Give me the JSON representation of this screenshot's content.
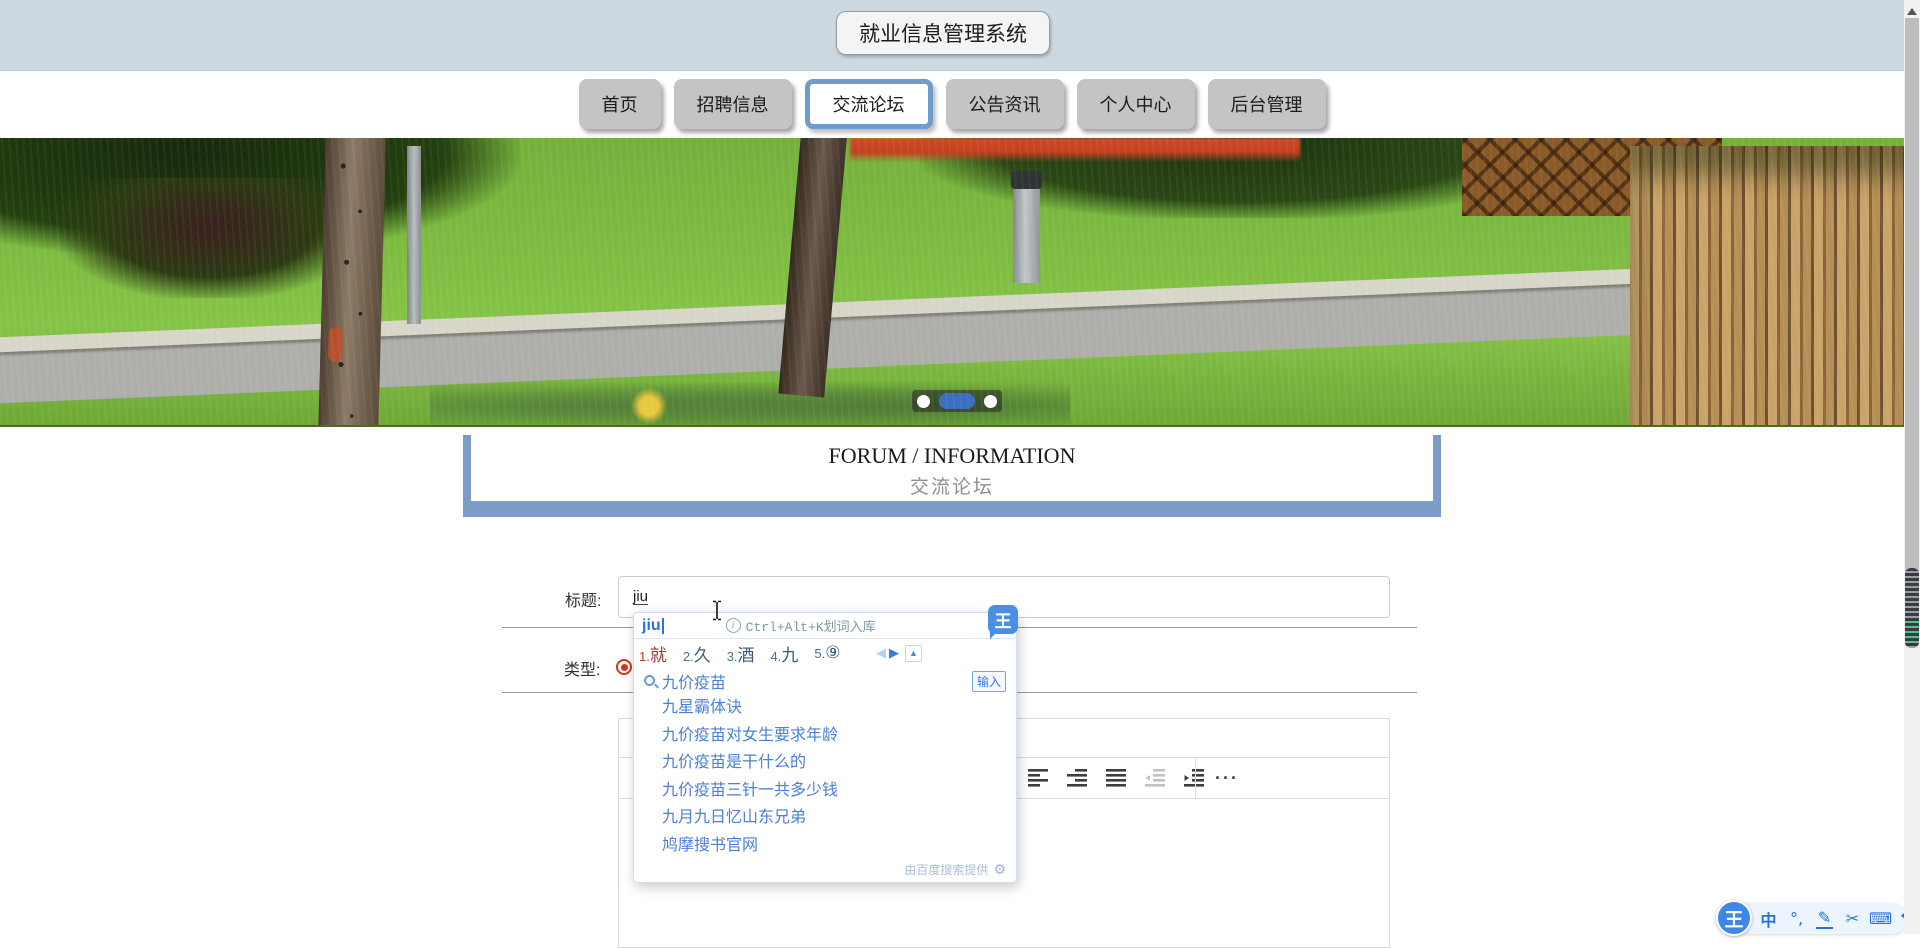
{
  "header": {
    "title": "就业信息管理系统"
  },
  "nav": {
    "items": [
      {
        "label": "首页",
        "active": false
      },
      {
        "label": "招聘信息",
        "active": false
      },
      {
        "label": "交流论坛",
        "active": true
      },
      {
        "label": "公告资讯",
        "active": false
      },
      {
        "label": "个人中心",
        "active": false
      },
      {
        "label": "后台管理",
        "active": false
      }
    ]
  },
  "banner": {
    "carousel": {
      "dot_count": 3,
      "active_index": 1
    }
  },
  "section": {
    "title_en": "FORUM / INFORMATION",
    "title_zh": "交流论坛"
  },
  "form": {
    "title_label": "标题:",
    "title_value": "jiu",
    "type_label": "类型:",
    "type_radio_selected": true
  },
  "editor": {
    "toolbar_icons": [
      "align-left",
      "align-right",
      "align-justify",
      "outdent",
      "indent"
    ],
    "disabled_icons": [
      "outdent"
    ],
    "more_label": "···"
  },
  "ime_popup": {
    "composition": "jiu",
    "hint": "Ctrl+Alt+K划词入库",
    "candidates": [
      {
        "num": "1.",
        "char": "就"
      },
      {
        "num": "2.",
        "char": "久"
      },
      {
        "num": "3.",
        "char": "酒"
      },
      {
        "num": "4.",
        "char": "九"
      },
      {
        "num": "5.",
        "char": "⑨"
      }
    ],
    "nav_icons": [
      "prev-page-icon",
      "next-page-icon",
      "page-up-icon"
    ],
    "search_text": "九价疫苗",
    "enter_label": "输入",
    "suggestions": [
      "九星霸体诀",
      "九价疫苗对女生要求年龄",
      "九价疫苗是干什么的",
      "九价疫苗三针一共多少钱",
      "九月九日忆山东兄弟",
      "鸠摩搜书官网"
    ],
    "footer": "由百度搜索提供"
  },
  "ime_bar": {
    "logo": "王",
    "mode": "中",
    "punct": "°,",
    "icons": [
      "chinese-mode-icon",
      "punctuation-icon",
      "handwriting-icon",
      "scissors-icon",
      "keyboard-icon",
      "skin-icon",
      "settings-icon"
    ]
  },
  "colors": {
    "topbar_bg": "#cdd9e2",
    "nav_active_border": "#6f9ccb",
    "forum_border": "#7b9cc7",
    "ime_blue": "#3a7ad9",
    "candidate_first": "#a03434",
    "radio_red": "#d5351f",
    "carousel_active": "#3a6fc0"
  }
}
